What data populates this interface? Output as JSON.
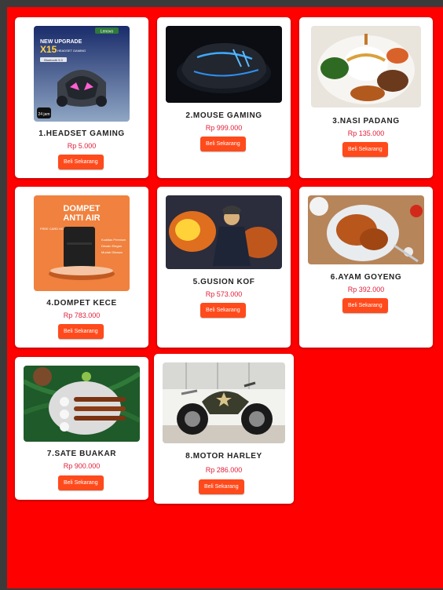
{
  "colors": {
    "page_bg": "#ff0000",
    "frame": "#3b3b3b",
    "button": "#ff4a1c",
    "price": "#e0203a"
  },
  "buy_label": "Beli Sekarang",
  "products": [
    {
      "name": "1.HEADSET GAMING",
      "price": "Rp 5.000",
      "image": "headset-image",
      "image_text": {
        "brand": "Lenovo",
        "l1": "NEW UPGRADE",
        "l2": "X15",
        "l3": "HEADSET GAMING",
        "bt": "Bluetooth 5.3",
        "hr": "24 jam"
      }
    },
    {
      "name": "2.MOUSE GAMING",
      "price": "Rp 999.000",
      "image": "mouse-image"
    },
    {
      "name": "3.NASI PADANG",
      "price": "Rp 135.000",
      "image": "food-image"
    },
    {
      "name": "4.DOMPET KECE",
      "price": "Rp 783.000",
      "image": "wallet-image",
      "image_text": {
        "t1": "DOMPET",
        "t2": "ANTI AIR",
        "sub": "FREE CARD HOLDER",
        "l1": "Kualitas Premium",
        "l2": "Desain Elegan",
        "l3": "Mudah Dibawa"
      }
    },
    {
      "name": "5.GUSION KOF",
      "price": "Rp 573.000",
      "image": "hero-image"
    },
    {
      "name": "6.AYAM GOYENG",
      "price": "Rp 392.000",
      "image": "chicken-image"
    },
    {
      "name": "7.SATE BUAKAR",
      "price": "Rp 900.000",
      "image": "satay-image"
    },
    {
      "name": "8.MOTOR HARLEY",
      "price": "Rp 286.000",
      "image": "motorcycle-image"
    }
  ]
}
